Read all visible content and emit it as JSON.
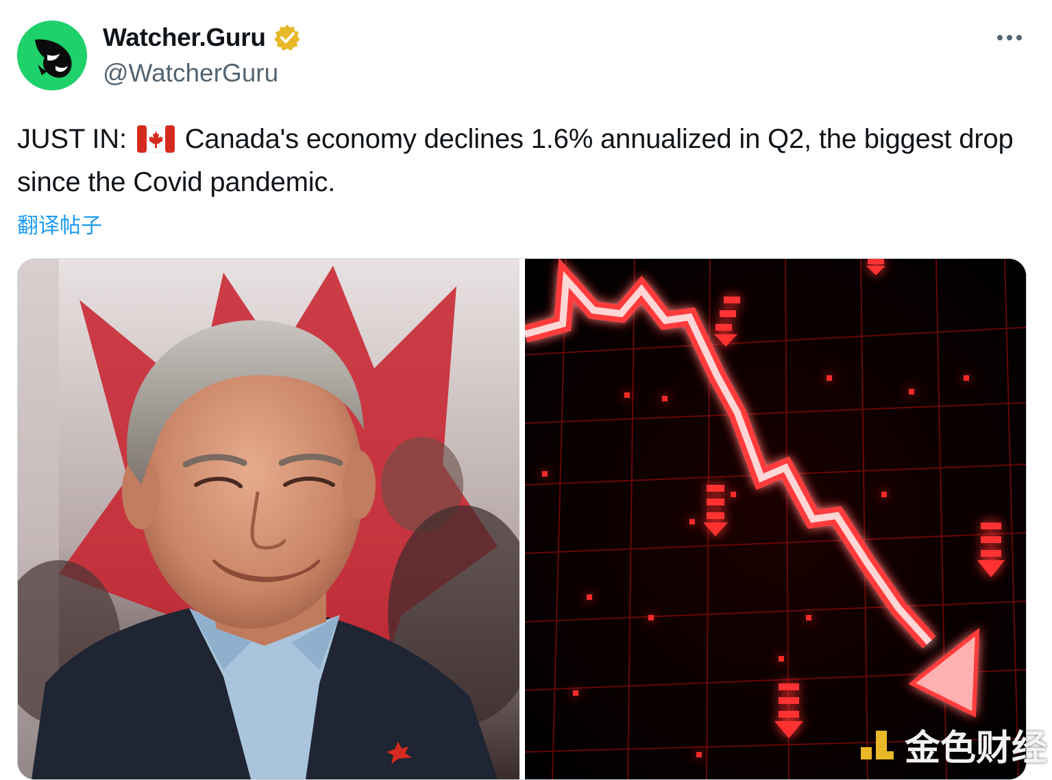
{
  "author": {
    "display_name": "Watcher.Guru",
    "handle": "@WatcherGuru",
    "verified": true,
    "badge_color": "#e8b829",
    "avatar_color": "#1fd16a",
    "avatar_icon": "orca-whale-icon"
  },
  "tweet": {
    "text_before_flag": "JUST IN: ",
    "flag_icon": "canada-flag-icon",
    "text_after_flag": " Canada's economy declines 1.6% annualized in Q2, the biggest drop since the Covid pandemic.",
    "translate_label": "翻译帖子"
  },
  "more_icon": "more-options-icon",
  "media": {
    "left_image": "portrait-photo",
    "right_image": "red-declining-chart-graphic"
  },
  "watermark": {
    "text": "金色财经",
    "logo_color": "#e8b829"
  }
}
